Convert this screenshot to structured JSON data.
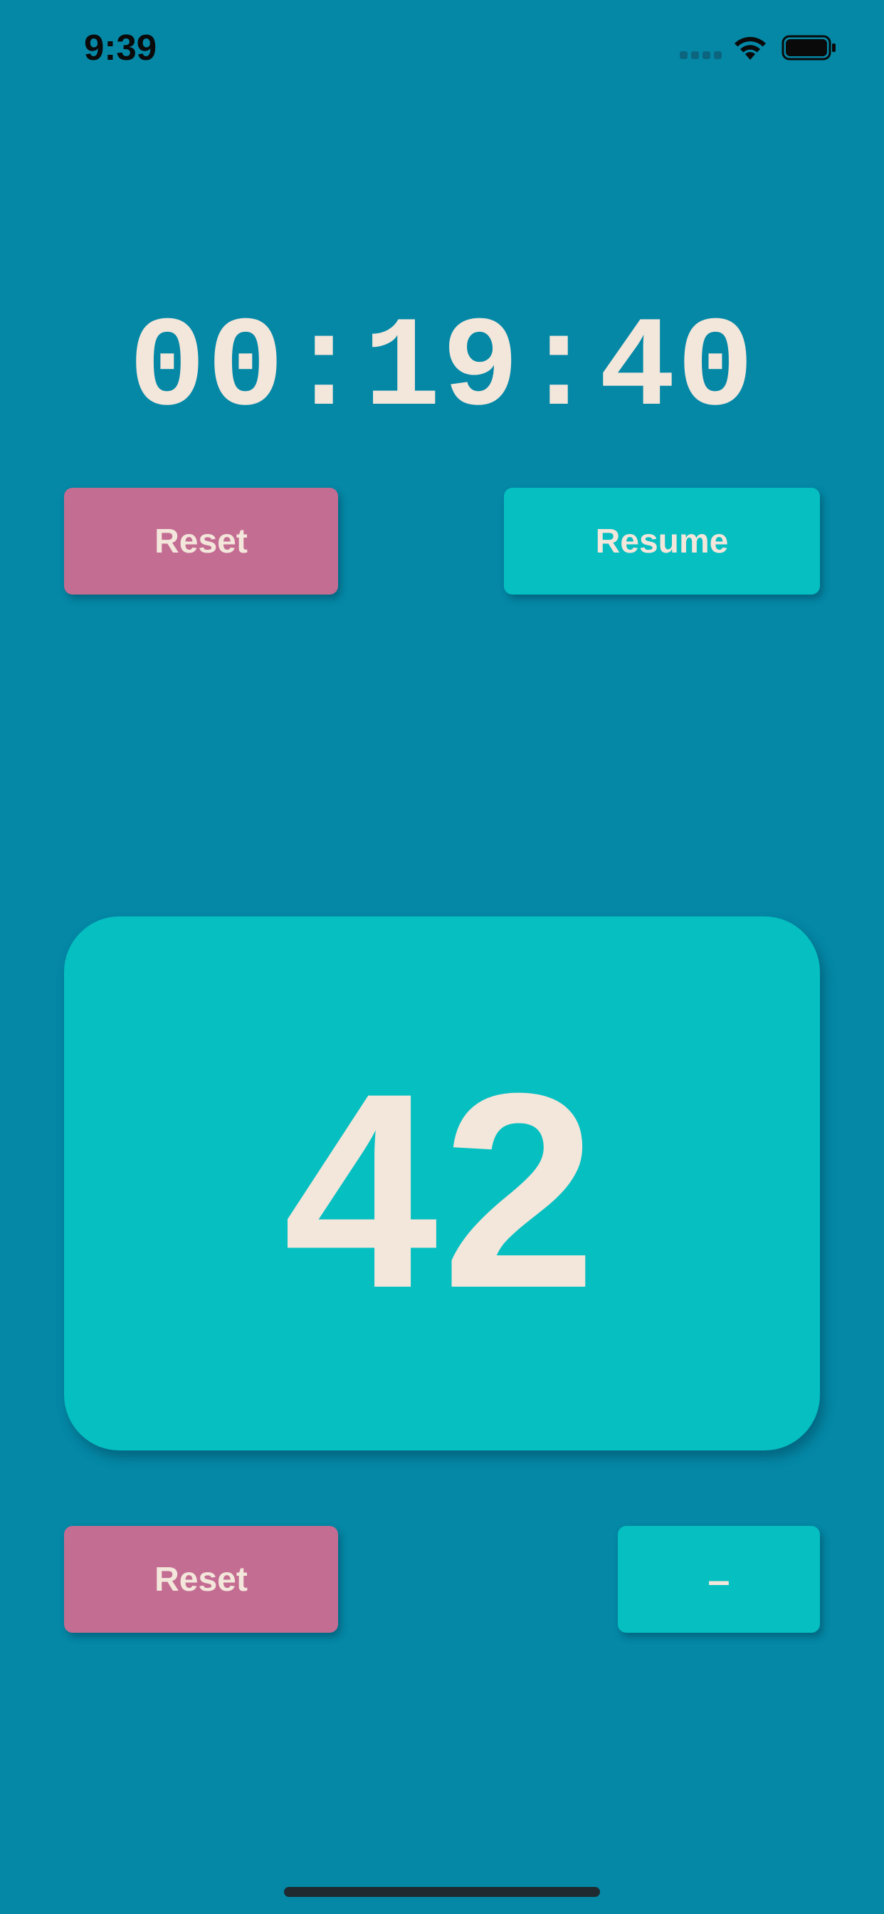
{
  "status_bar": {
    "time": "9:39"
  },
  "timer": {
    "display": "00:19:40",
    "reset_label": "Reset",
    "resume_label": "Resume"
  },
  "counter": {
    "value": "42",
    "reset_label": "Reset",
    "decrement_label": "–"
  },
  "colors": {
    "background": "#0488a6",
    "accent_teal": "#06bfc1",
    "accent_pink": "#c46d93",
    "text_light": "#f3e6db"
  },
  "icons": {
    "signal": "cellular-signal-icon",
    "wifi": "wifi-icon",
    "battery": "battery-icon"
  }
}
